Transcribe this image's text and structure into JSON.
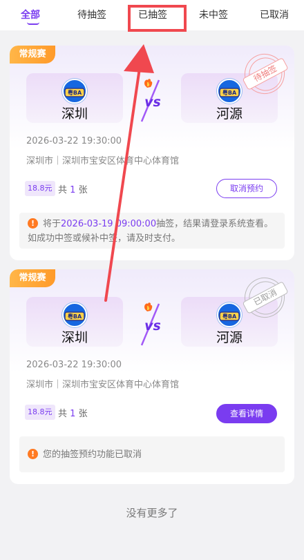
{
  "tabs": [
    {
      "label": "全部",
      "active": true
    },
    {
      "label": "待抽签",
      "active": false
    },
    {
      "label": "已抽签",
      "active": false
    },
    {
      "label": "未中签",
      "active": false
    },
    {
      "label": "已取消",
      "active": false
    }
  ],
  "cards": [
    {
      "tag": "常规赛",
      "team_logo_text": "粤BA",
      "home_team": "深圳",
      "away_team": "河源",
      "stamp": "待抽签",
      "datetime": "2026-03-22 19:30:00",
      "venue": "深圳市｜深圳市宝安区体育中心体育馆",
      "price": "18.8元",
      "count_prefix": "共",
      "count": "1",
      "count_unit": "张",
      "button": "取消预约",
      "notice_before": "将于",
      "notice_highlight": "2026-03-19 09:00:00",
      "notice_after": "抽签，结果请登录系统查看。如成功中签或候补中签，请及时支付。"
    },
    {
      "tag": "常规赛",
      "team_logo_text": "粤BA",
      "home_team": "深圳",
      "away_team": "河源",
      "stamp": "已取消",
      "datetime": "2026-03-22 19:30:00",
      "venue": "深圳市｜深圳市宝安区体育中心体育馆",
      "price": "18.8元",
      "count_prefix": "共",
      "count": "1",
      "count_unit": "张",
      "button": "查看详情",
      "notice": "您的抽签预约功能已取消"
    }
  ],
  "footer": {
    "no_more": "没有更多了"
  },
  "colors": {
    "accent": "#7a3cf0",
    "tag_orange": "#ff9a2a",
    "warning": "#ff7a22",
    "annotation_red": "#f0484f"
  },
  "icons": {
    "warning": "warning-icon",
    "vs": "vs-icon",
    "team_logo": "team-logo-icon"
  }
}
